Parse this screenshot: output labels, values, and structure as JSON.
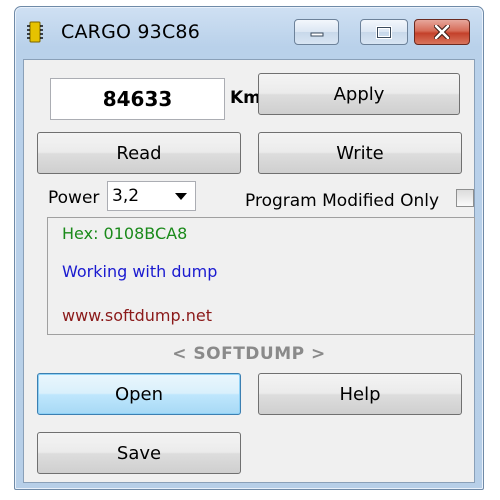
{
  "window": {
    "title": "CARGO 93C86",
    "controls": {
      "minimize": "minimize",
      "maximize": "maximize",
      "close": "close"
    }
  },
  "km": {
    "value": "84633",
    "unit": "Km"
  },
  "buttons": {
    "apply": "Apply",
    "read": "Read",
    "write": "Write",
    "open": "Open",
    "help": "Help",
    "save": "Save"
  },
  "power": {
    "label": "Power",
    "selected": "3,2"
  },
  "program_modified_only": {
    "label": "Program Modified Only",
    "checked": false
  },
  "log": [
    {
      "text": "Hex: 0108BCA8",
      "color": "#1a8a1a"
    },
    {
      "text": "Working with dump",
      "color": "#1a1ad0"
    },
    {
      "text": "www.softdump.net",
      "color": "#8b1a1a"
    }
  ],
  "brand": "< SOFTDUMP >",
  "colors": {
    "title_bar": "#b9d1ea",
    "close_button": "#c4412b",
    "focus_button": "#bee6fd"
  }
}
